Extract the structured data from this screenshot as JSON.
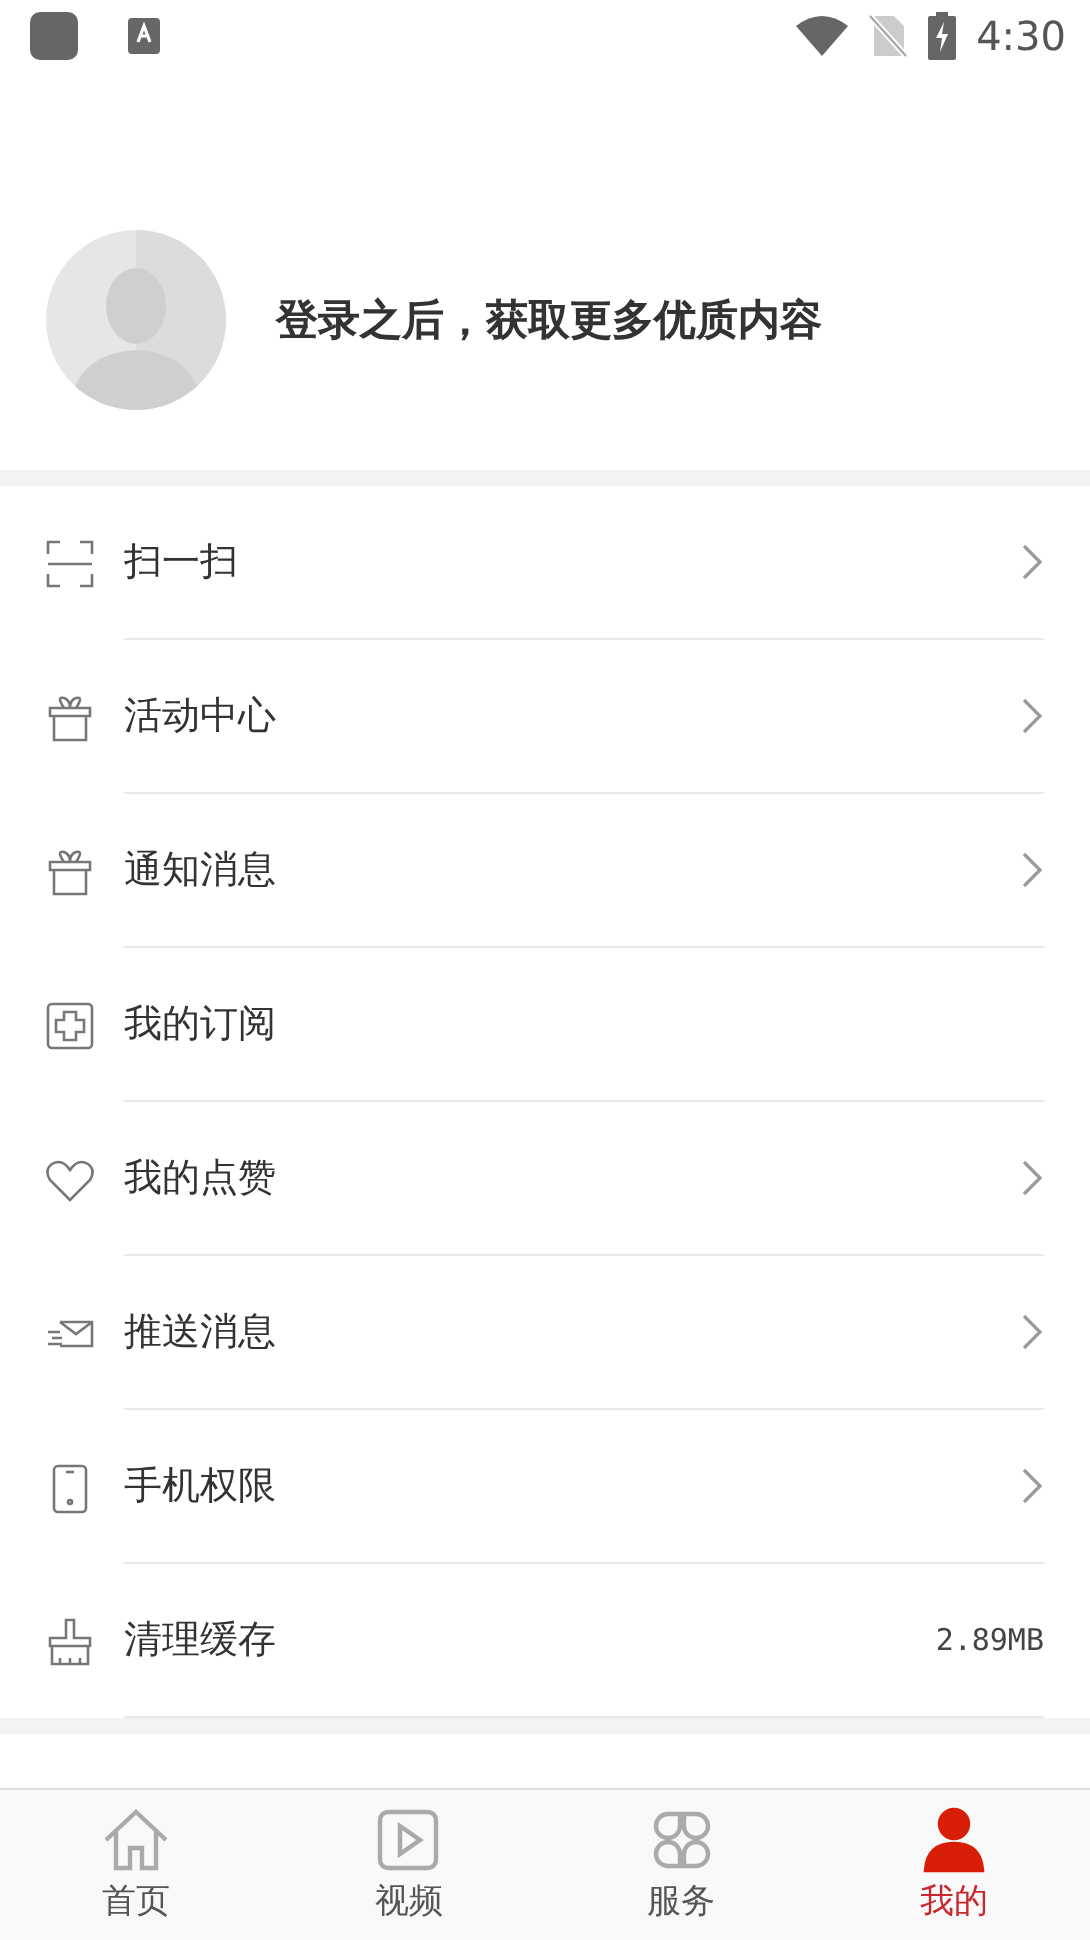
{
  "status_bar": {
    "time": "4:30"
  },
  "profile": {
    "prompt": "登录之后，获取更多优质内容"
  },
  "menu": [
    {
      "label": "扫一扫",
      "kind": "scan",
      "chevron": true
    },
    {
      "label": "活动中心",
      "kind": "gift",
      "chevron": true
    },
    {
      "label": "通知消息",
      "kind": "gift",
      "chevron": true
    },
    {
      "label": "我的订阅",
      "kind": "plus",
      "chevron": false
    },
    {
      "label": "我的点赞",
      "kind": "heart",
      "chevron": true
    },
    {
      "label": "推送消息",
      "kind": "mail",
      "chevron": true
    },
    {
      "label": "手机权限",
      "kind": "phone",
      "chevron": true
    },
    {
      "label": "清理缓存",
      "kind": "brush",
      "chevron": false,
      "value": "2.89MB"
    }
  ],
  "tabs": [
    {
      "label": "首页",
      "kind": "home",
      "selected": false
    },
    {
      "label": "视频",
      "kind": "video",
      "selected": false
    },
    {
      "label": "服务",
      "kind": "grid",
      "selected": false
    },
    {
      "label": "我的",
      "kind": "person",
      "selected": true
    }
  ]
}
